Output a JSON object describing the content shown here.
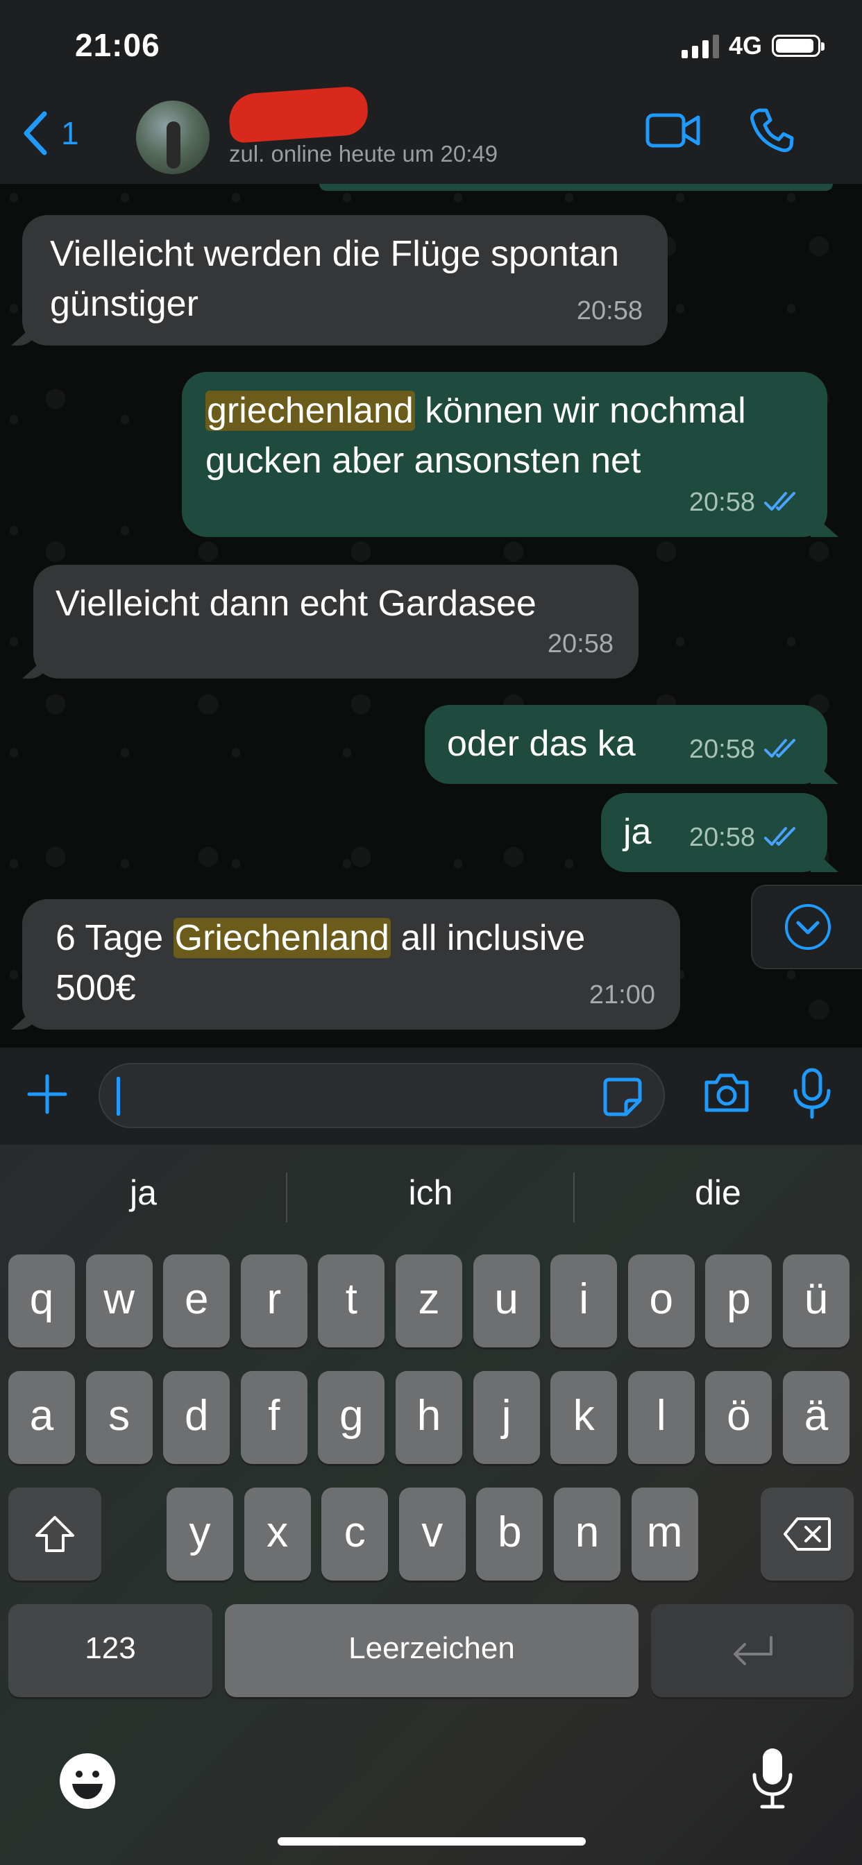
{
  "status_bar": {
    "time": "21:06",
    "network": "4G"
  },
  "header": {
    "back_count": "1",
    "contact_status": "zul. online heute um 20:49"
  },
  "messages": [
    {
      "direction": "in",
      "text": "Vielleicht werden die Flüge spontan günstiger",
      "time": "20:58"
    },
    {
      "direction": "out",
      "highlight": "griechenland",
      "text_rest": " können wir nochmal gucken aber ansonsten net",
      "time": "20:58"
    },
    {
      "direction": "in",
      "text": "Vielleicht dann echt Gardasee",
      "time": "20:58"
    },
    {
      "direction": "out",
      "text": "oder das ka",
      "time": "20:58"
    },
    {
      "direction": "out",
      "text": "ja",
      "time": "20:58"
    },
    {
      "direction": "in",
      "text_before": "6 Tage ",
      "highlight": "Griechenland",
      "text_after": " all inclusive 500€",
      "time": "21:00"
    }
  ],
  "keyboard": {
    "suggestions": [
      "ja",
      "ich",
      "die"
    ],
    "row1": [
      "q",
      "w",
      "e",
      "r",
      "t",
      "z",
      "u",
      "i",
      "o",
      "p",
      "ü"
    ],
    "row2": [
      "a",
      "s",
      "d",
      "f",
      "g",
      "h",
      "j",
      "k",
      "l",
      "ö",
      "ä"
    ],
    "row3": [
      "y",
      "x",
      "c",
      "v",
      "b",
      "n",
      "m"
    ],
    "numbers_key": "123",
    "space_key": "Leerzeichen"
  },
  "colors": {
    "accent": "#1f9bff",
    "outgoing_bubble": "#1e4b3d",
    "incoming_bubble": "#353638",
    "highlight": "#6b5c1c"
  }
}
